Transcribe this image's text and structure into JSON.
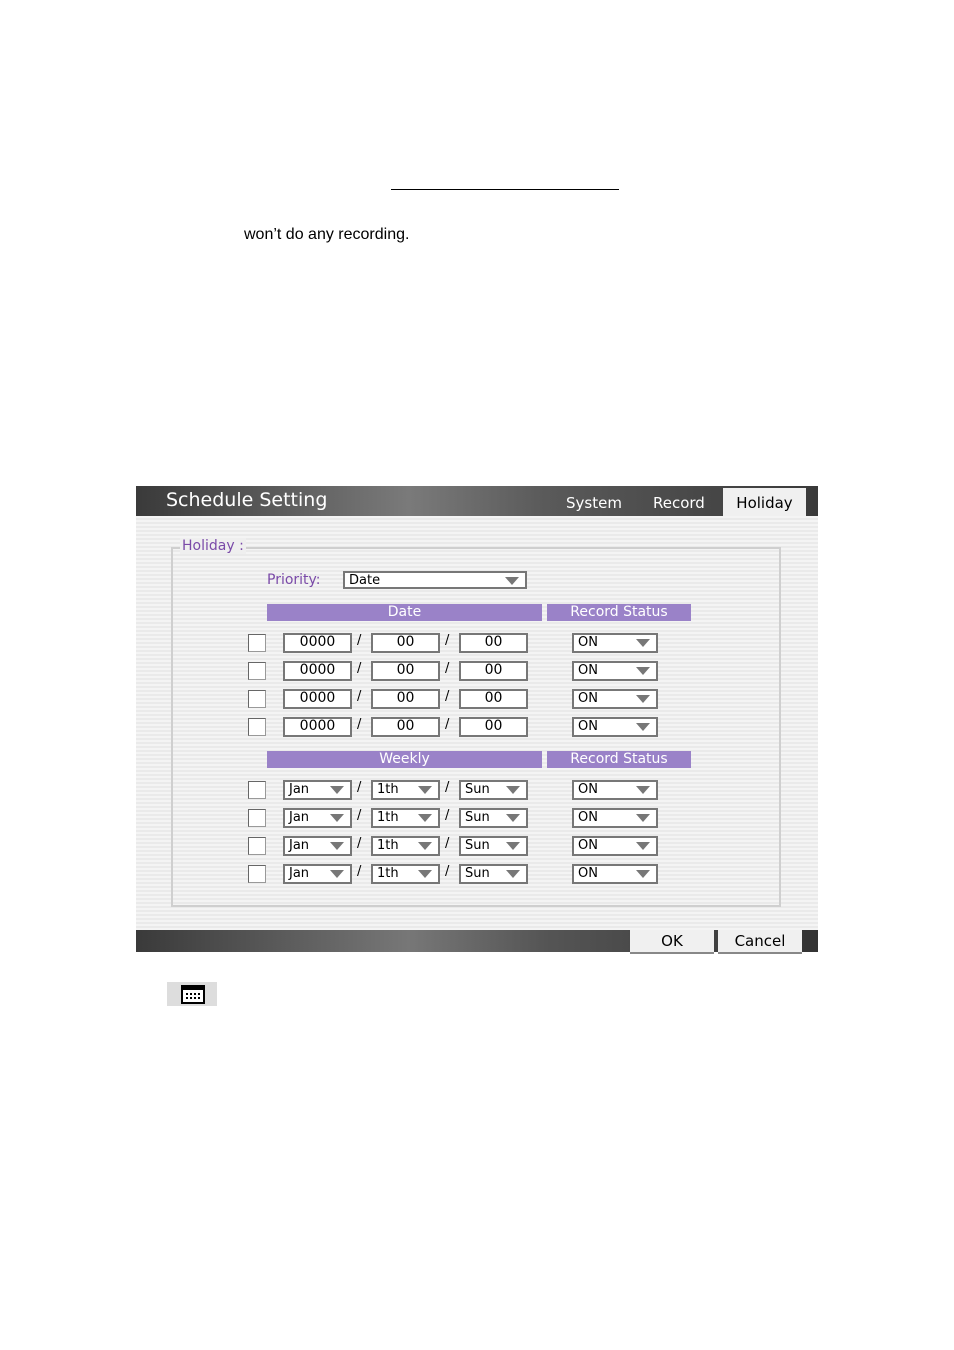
{
  "doc": {
    "text": "won’t do any recording."
  },
  "window": {
    "title": "Schedule Setting",
    "tabs": [
      "System",
      "Record",
      "Holiday"
    ],
    "active_tab": "Holiday"
  },
  "group": {
    "label": "Holiday :"
  },
  "priority": {
    "label": "Priority:",
    "value": "Date"
  },
  "headers": {
    "date": "Date",
    "weekly": "Weekly",
    "record_status": "Record Status"
  },
  "separator": "/",
  "date_rows": [
    {
      "checked": false,
      "year": "0000",
      "month": "00",
      "day": "00",
      "status": "ON"
    },
    {
      "checked": false,
      "year": "0000",
      "month": "00",
      "day": "00",
      "status": "ON"
    },
    {
      "checked": false,
      "year": "0000",
      "month": "00",
      "day": "00",
      "status": "ON"
    },
    {
      "checked": false,
      "year": "0000",
      "month": "00",
      "day": "00",
      "status": "ON"
    }
  ],
  "weekly_rows": [
    {
      "checked": false,
      "month": "Jan",
      "week": "1th",
      "weekday": "Sun",
      "status": "ON"
    },
    {
      "checked": false,
      "month": "Jan",
      "week": "1th",
      "weekday": "Sun",
      "status": "ON"
    },
    {
      "checked": false,
      "month": "Jan",
      "week": "1th",
      "weekday": "Sun",
      "status": "ON"
    },
    {
      "checked": false,
      "month": "Jan",
      "week": "1th",
      "weekday": "Sun",
      "status": "ON"
    }
  ],
  "footer": {
    "ok": "OK",
    "cancel": "Cancel"
  },
  "icons": {
    "calendar": "calendar-icon"
  },
  "colors": {
    "accent": "#9a82c8",
    "label": "#7a4aa8"
  }
}
